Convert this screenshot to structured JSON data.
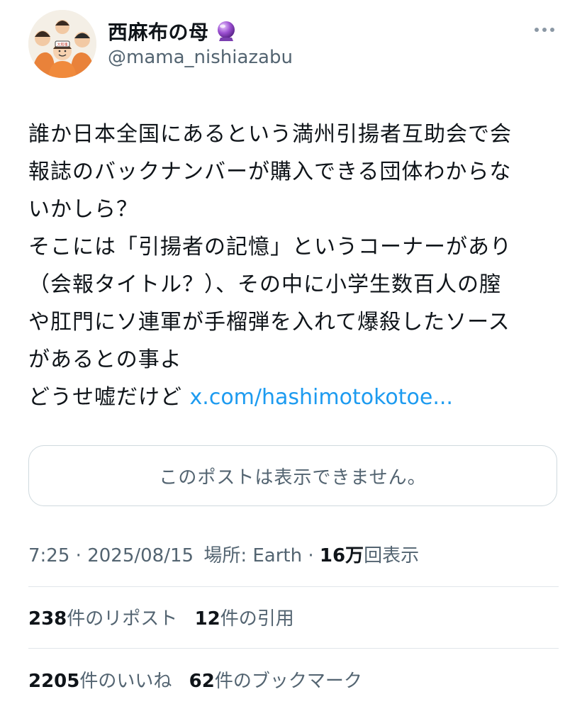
{
  "author": {
    "display_name": "西麻布の母",
    "badge_icon": "crystal-ball-emoji",
    "handle": "@mama_nishiazabu"
  },
  "post": {
    "lines": [
      "誰か日本全国にあるという満州引揚者互助会で会",
      "報誌のバックナンバーが購入できる団体わからな",
      "いかしら？",
      "そこには「引揚者の記憶」というコーナーがあり",
      "（会報タイトル？）、その中に小学生数百人の膣",
      "や肛門にソ連軍が手榴弾を入れて爆殺したソース",
      "があるとの事よ"
    ],
    "last_line_prefix": "どうせ嘘だけど ",
    "link_text": "x.com/hashimotokotoe..."
  },
  "quoted_notice": "このポストは表示できません。",
  "meta": {
    "time": "7:25",
    "date": "2025/08/15",
    "location_label": "場所: Earth",
    "views_count": "16",
    "views_unit": "万",
    "views_label": "回表示"
  },
  "stats": {
    "reposts_count": "238",
    "reposts_label": "件のリポスト",
    "quotes_count": "12",
    "quotes_label": "件の引用",
    "likes_count": "2205",
    "likes_label": "件のいいね",
    "bookmarks_count": "62",
    "bookmarks_label": "件のブックマーク"
  },
  "colors": {
    "link": "#1d9bf0",
    "secondary_text": "#536471",
    "primary_text": "#0f1419",
    "border": "#cfd9de"
  }
}
